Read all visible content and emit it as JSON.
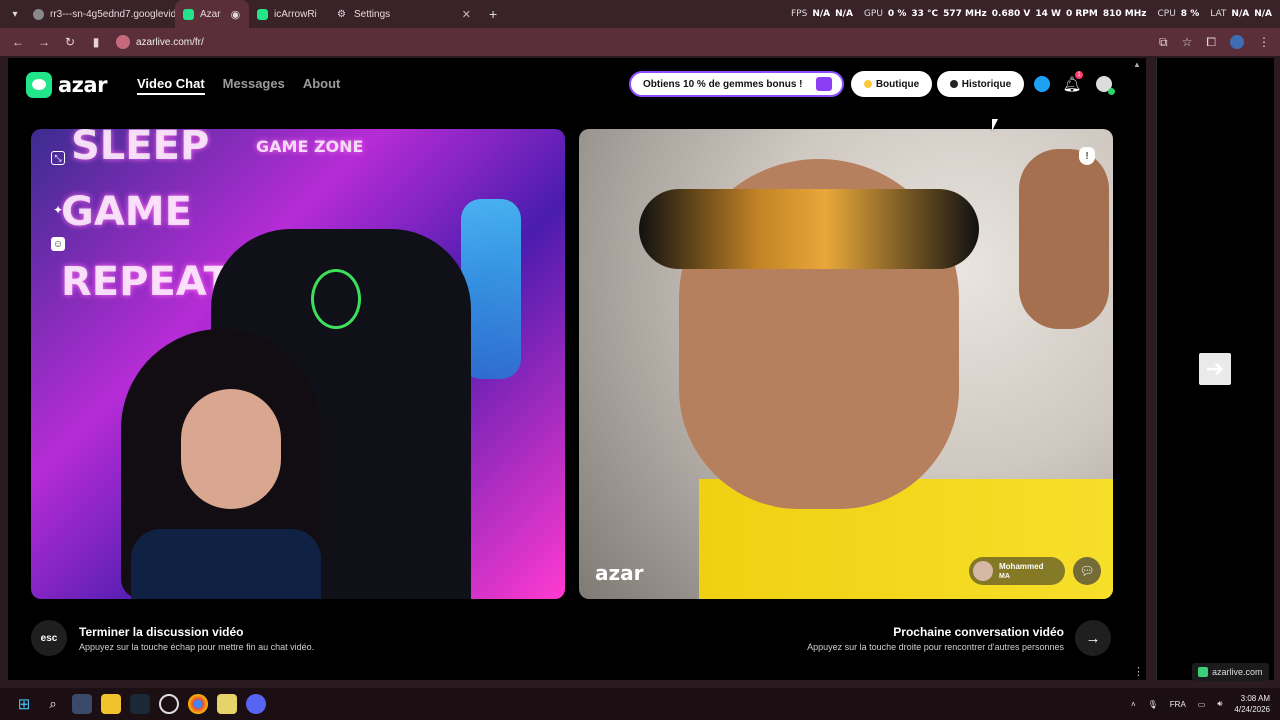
{
  "browser": {
    "tabs": [
      {
        "title": "rr3---sn-4g5ednd7.googlevide",
        "active": false
      },
      {
        "title": "Azar",
        "active": true
      },
      {
        "title": "icArrowRi",
        "active": false
      },
      {
        "title": "Settings",
        "active": false
      }
    ],
    "new_tab": "+",
    "url": "azarlive.com/fr/"
  },
  "hud": {
    "fps_label": "FPS",
    "fps": "N/A",
    "fps2": "N/A",
    "gpu_label": "GPU",
    "gpu_load": "0 %",
    "gpu_temp": "33 °C",
    "gpu_clock": "577 MHz",
    "gpu_volt": "0.680 V",
    "gpu_power": "14 W",
    "gpu_rpm": "0 RPM",
    "gpu_mem": "810 MHz",
    "cpu_label": "CPU",
    "cpu_load": "8 %",
    "lat_label": "LAT",
    "lat1": "N/A",
    "lat2": "N/A"
  },
  "site": {
    "logo": "azar",
    "nav": [
      {
        "label": "Video Chat",
        "active": true
      },
      {
        "label": "Messages",
        "active": false
      },
      {
        "label": "About",
        "active": false
      }
    ],
    "promo": "Obtiens 10 % de gemmes bonus !",
    "boutique": "Boutique",
    "historique": "Historique",
    "notification_count": "1"
  },
  "left_video": {
    "neon_1": "SLEEP",
    "neon_2": "GAME",
    "neon_3": "REPEAT",
    "neon_4": "GAME ZONE"
  },
  "right_video": {
    "watermark": "azar",
    "peer_name": "Mohammed",
    "peer_country": "MA"
  },
  "controls": {
    "esc_key": "esc",
    "end_title": "Terminer la discussion vidéo",
    "end_sub": "Appuyez sur la touche échap pour mettre fin au chat vidéo.",
    "next_title": "Prochaine conversation vidéo",
    "next_sub": "Appuyez sur la touche droite pour rencontrer d'autres personnes"
  },
  "side": {
    "status": "azarlive.com"
  },
  "taskbar": {
    "lang": "FRA",
    "time": "3:08 AM",
    "date": "4/24/2026"
  },
  "colors": {
    "brand_green": "#22e58a",
    "promo_border": "#8b4dff",
    "chrome_bg": "#5a2f3a"
  }
}
